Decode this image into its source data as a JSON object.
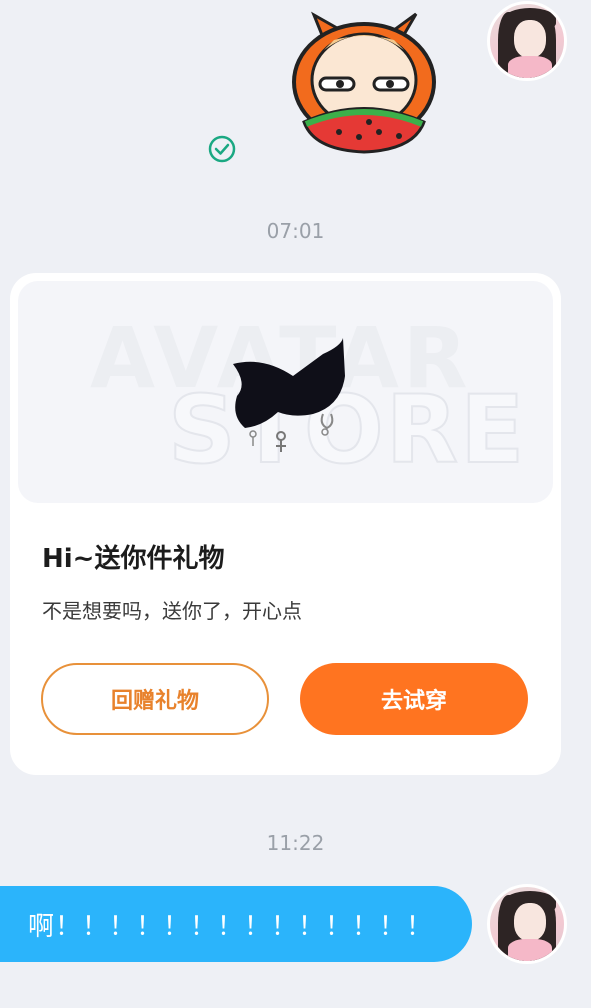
{
  "messages": {
    "time_1": "07:01",
    "time_2": "11:22",
    "text_message": "啊！！！！！！！！！！！！！！"
  },
  "gift_card": {
    "watermark_line1": "AVATAR",
    "watermark_line2": "STORE",
    "title": "Hi~送你件礼物",
    "subtitle": "不是想要吗，送你了，开心点",
    "return_gift_label": "回赠礼物",
    "try_on_label": "去试穿"
  },
  "colors": {
    "background": "#eef0f5",
    "accent_orange": "#ff7420",
    "bubble_blue": "#2bb4fb",
    "check_green": "#1aa882"
  },
  "icons": [
    "sent-check-icon",
    "avatar-image",
    "sticker-image",
    "gift-item-image"
  ]
}
